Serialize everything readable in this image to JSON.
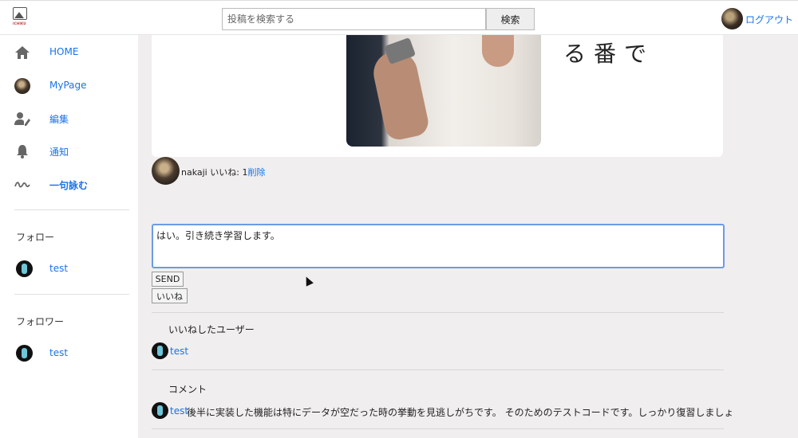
{
  "header": {
    "logo_text": "ICHIKU",
    "search_placeholder": "投稿を検索する",
    "search_button": "検索",
    "logout_label": "ログアウト"
  },
  "sidebar": {
    "nav": [
      {
        "label": "HOME",
        "icon": "home-icon"
      },
      {
        "label": "MyPage",
        "icon": "avatar"
      },
      {
        "label": "編集",
        "icon": "user-edit-icon"
      },
      {
        "label": "通知",
        "icon": "bell-icon"
      },
      {
        "label": "一句詠む",
        "icon": "wave-icon"
      }
    ],
    "following_heading": "フォロー",
    "following": [
      {
        "name": "test"
      }
    ],
    "followers_heading": "フォロワー",
    "followers": [
      {
        "name": "test"
      }
    ]
  },
  "post": {
    "poem_fragment": "る番で",
    "author": "nakaji",
    "likes_label": "いいね: 1",
    "delete_label": "削除"
  },
  "comment_form": {
    "value": "はい。引き続き学習します。",
    "send_label": "SEND",
    "like_label": "いいね"
  },
  "likes_section": {
    "title": "いいねしたユーザー",
    "users": [
      {
        "name": "test"
      }
    ]
  },
  "comments_section": {
    "title": "コメント",
    "comments": [
      {
        "user": "test",
        "text": "後半に実装した機能は特にデータが空だった時の挙動を見逃しがちです。 そのためのテストコードです。しっかり復習しましょう。"
      }
    ]
  },
  "colors": {
    "link": "#1a73e8",
    "main_bg": "#f0eeee",
    "focus_border": "#6b9be6"
  }
}
